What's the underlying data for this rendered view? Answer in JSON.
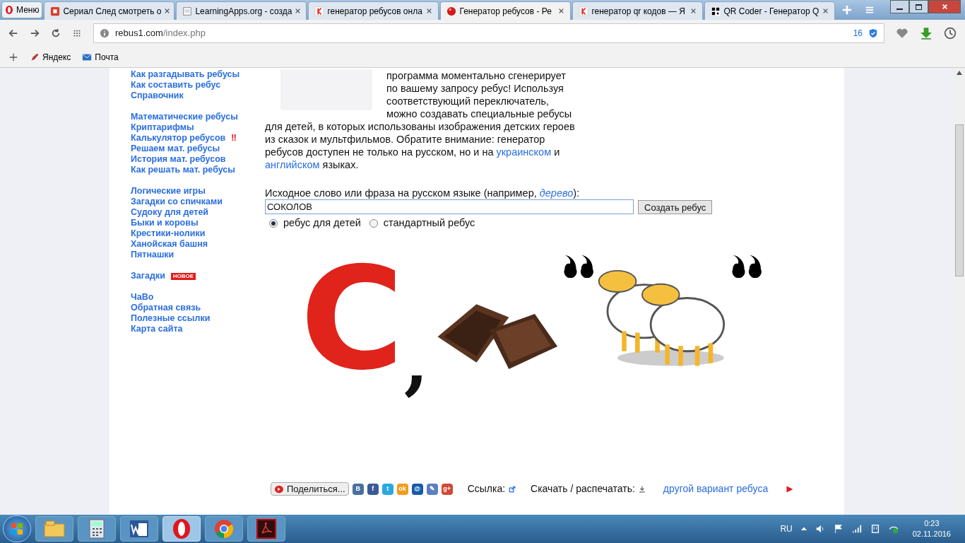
{
  "browser": {
    "menu_label": "Меню",
    "tabs": [
      {
        "title": "Сериал След смотреть о",
        "selected": false
      },
      {
        "title": "LearningApps.org - созда",
        "selected": false
      },
      {
        "title": "генератор ребусов онла",
        "selected": false
      },
      {
        "title": "Генератор ребусов - Ре",
        "selected": true
      },
      {
        "title": "генератор qr кодов — Я",
        "selected": false
      },
      {
        "title": "QR Coder - Генератор Q",
        "selected": false
      }
    ],
    "url_host": "rebus1.com",
    "url_path": "/index.php",
    "blocked_count": "16",
    "bookmarks": [
      "Яндекс",
      "Почта"
    ]
  },
  "sidebar": {
    "groups": [
      [
        {
          "label": "Как разгадывать ребусы"
        },
        {
          "label": "Как составить ребус"
        },
        {
          "label": "Справочник"
        }
      ],
      [
        {
          "label": "Математические ребусы"
        },
        {
          "label": "Криптарифмы"
        },
        {
          "label": "Калькулятор ребусов",
          "mark": "‼"
        },
        {
          "label": "Решаем мат. ребусы"
        },
        {
          "label": "История мат. ребусов"
        },
        {
          "label": "Как решать мат. ребусы"
        }
      ],
      [
        {
          "label": "Логические игры"
        },
        {
          "label": "Загадки со спичками"
        },
        {
          "label": "Судоку для детей"
        },
        {
          "label": "Быки и коровы"
        },
        {
          "label": "Крестики-нолики"
        },
        {
          "label": "Ханойская башня"
        },
        {
          "label": "Пятнашки"
        }
      ],
      [
        {
          "label": "Загадки",
          "badge": "НОВОЕ"
        }
      ],
      [
        {
          "label": "ЧаВо"
        },
        {
          "label": "Обратная связь"
        },
        {
          "label": "Полезные ссылки"
        },
        {
          "label": "Карта сайта"
        }
      ]
    ]
  },
  "intro": {
    "lines_beside": [
      "программа моментально сгенерирует",
      "по вашему запросу ребус! Используя",
      "соответствующий переключатель,",
      "можно создавать специальные ребусы"
    ],
    "text_below": "для детей, в которых использованы изображения детских героев из сказок и мультфильмов. Обратите внимание: генератор ребусов доступен не только на русском, но и на",
    "link_1": "украинском",
    "joiner": "и",
    "link_2": "английском",
    "tail": "языках."
  },
  "form": {
    "label": "Исходное слово или фраза на русском языке (например, ",
    "example": "дерево",
    "label_end": "):",
    "value": "СОКОЛОВ",
    "submit": "Создать ребус",
    "options": [
      {
        "label": "ребус для детей",
        "selected": true
      },
      {
        "label": "стандартный ребус",
        "selected": false
      }
    ]
  },
  "rebus": [
    {
      "kind": "letter",
      "text": "С"
    },
    {
      "kind": "comma",
      "text": ","
    },
    {
      "kind": "chocolate"
    },
    {
      "kind": "quote"
    },
    {
      "kind": "sheep"
    },
    {
      "kind": "quote"
    }
  ],
  "footer": {
    "share": "Поделиться...",
    "link_label": "Ссылка:",
    "download_label": "Скачать / распечатать:",
    "next": "другой вариант ребуса",
    "socials": [
      {
        "text": "В",
        "color": "#4a6f9c"
      },
      {
        "text": "f",
        "color": "#3b5998"
      },
      {
        "text": "t",
        "color": "#2aa9e0"
      },
      {
        "text": "ok",
        "color": "#f59a1a"
      },
      {
        "text": "@",
        "color": "#165ba9"
      },
      {
        "text": "✎",
        "color": "#5d7fbf"
      },
      {
        "text": "g+",
        "color": "#d34836"
      }
    ]
  },
  "taskbar": {
    "apps": [
      {
        "selected": false
      },
      {
        "selected": false
      },
      {
        "selected": false
      },
      {
        "selected": true
      },
      {
        "selected": false
      },
      {
        "selected": false
      }
    ],
    "lang": "RU",
    "time": "0:23",
    "date": "02.11.2016"
  }
}
